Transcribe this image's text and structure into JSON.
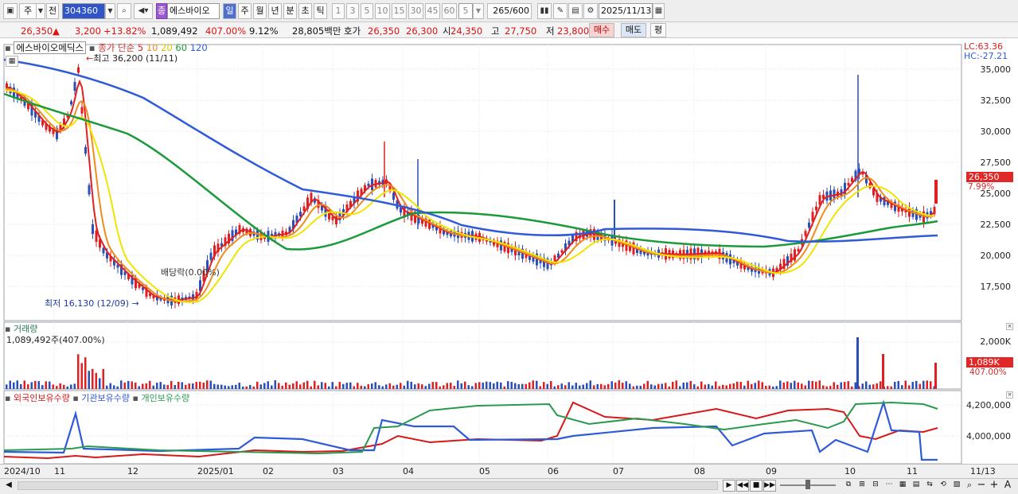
{
  "toolbar": {
    "period_type": "주",
    "prev_label": "전",
    "stock_code": "304360",
    "stock_name": "에스바이오",
    "category_badge": "종",
    "periods": [
      "일",
      "주",
      "월",
      "년",
      "분",
      "초",
      "틱"
    ],
    "intervals": [
      "1",
      "3",
      "5",
      "10",
      "15",
      "30",
      "45",
      "60"
    ],
    "interval_value": "5",
    "bar_count": "265",
    "bar_total": "/600",
    "date": "2025/11/13"
  },
  "quote": {
    "price": "26,350",
    "arrow": "▲",
    "change": "3,200",
    "change_pct": "+13.82%",
    "volume": "1,089,492",
    "volume_ratio": "407.00%",
    "turnover": "9.12%",
    "amount": "28,805백만",
    "hoga_label": "호가",
    "ask": "26,350",
    "bid": "26,300",
    "open_label": "시",
    "open": "24,350",
    "high_label": "고",
    "high": "27,750",
    "low_label": "저",
    "low": "23,800",
    "buy_label": "매수",
    "sell_label": "매도",
    "avg_label": "평"
  },
  "price_panel": {
    "stock_name": "에스바이오메딕스",
    "ma_label": "종가 단순",
    "ma_periods": [
      "5",
      "10",
      "20",
      "60",
      "120"
    ],
    "ma_colors": [
      "#e02020",
      "#f08c1c",
      "#f0e400",
      "#1a9a3a",
      "#2f5ad8"
    ],
    "lc_label": "LC:63.36",
    "hc_label": "HC:-27.21",
    "current_price_tag": "26,350",
    "current_pct_tag": "7.99%",
    "high_annotation": "최고 36,200 (11/11)",
    "low_annotation": "최저 16,130 (12/09)",
    "dividend_annotation": "배당락(0.00%)",
    "y_ticks": [
      "35,000",
      "32,500",
      "30,000",
      "27,500",
      "25,000",
      "22,500",
      "20,000",
      "17,500"
    ]
  },
  "volume_panel": {
    "title": "거래량",
    "current_value": "1,089,492주(407.00%)",
    "y_tick": "2,000K",
    "tag_value": "1,089K",
    "tag_pct": "407.00%"
  },
  "holdings_panel": {
    "series_labels": [
      "외국인보유수량",
      "기관보유수량",
      "개인보유수량"
    ],
    "series_colors": [
      "#d81818",
      "#2f5ad8",
      "#2a9a4e"
    ],
    "y_ticks": [
      "4,200,000",
      "4,000,000"
    ]
  },
  "x_axis": {
    "labels": [
      "2024/10",
      "11",
      "12",
      "2025/01",
      "02",
      "03",
      "04",
      "05",
      "06",
      "07",
      "08",
      "09",
      "10",
      "11"
    ],
    "last_date": "11/13"
  },
  "icons": [
    "layout-icon",
    "search-icon",
    "speaker-icon",
    "candle-icon",
    "edit-icon",
    "save-icon",
    "settings-icon",
    "calendar-icon",
    "play-icon",
    "rewind-icon",
    "stop-icon",
    "fast-forward-icon",
    "zoom-out-icon",
    "zoom-in-icon",
    "text-tool-icon"
  ]
}
